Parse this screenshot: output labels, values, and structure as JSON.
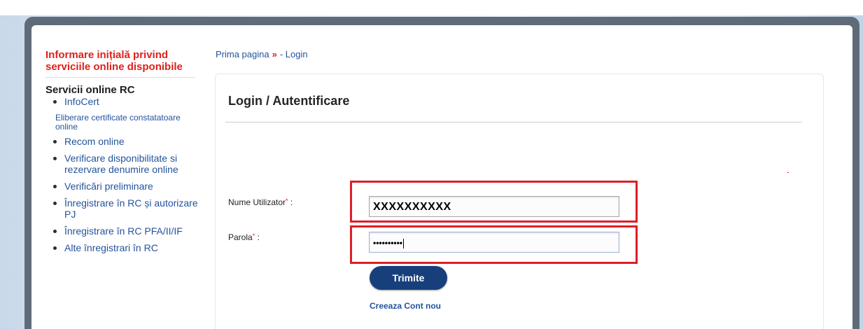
{
  "sidebar": {
    "info_link": "Informare inițială privind serviciile online disponibile",
    "section_title": "Servicii online RC",
    "item_infocert": "InfoCert",
    "plain_item": "Eliberare certificate constatatoare online",
    "items": [
      "Recom online",
      "Verificare disponibilitate si rezervare denumire online",
      "Verificări preliminare",
      "Înregistrare în RC și autorizare PJ",
      "Înregistrare în RC PFA/II/IF",
      "Alte înregistrari în RC"
    ]
  },
  "breadcrumb": {
    "home": "Prima pagina",
    "separator": "»",
    "current": "- Login"
  },
  "login": {
    "title": "Login / Autentificare",
    "username_label": "Nume Utilizator",
    "password_label": "Parola",
    "required_mark": "*",
    "label_suffix": " :",
    "username_value": "XXXXXXXXXX",
    "password_masked": "••••••••••",
    "submit_label": "Trimite",
    "new_account_label": "Creeaza Cont nou"
  },
  "colors": {
    "accent_red": "#e0201b",
    "link_blue": "#23539d",
    "button_blue": "#163f7c",
    "highlight_red": "#dd1f26"
  }
}
